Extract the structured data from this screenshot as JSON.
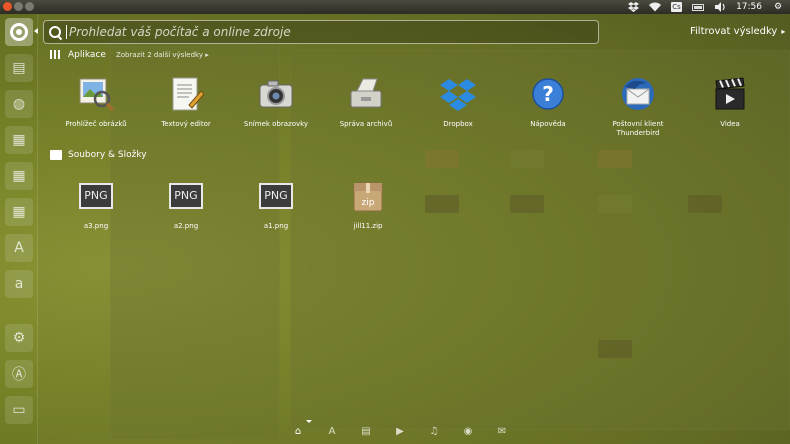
{
  "top_panel": {
    "time": "17:56",
    "keyboard_layout": "Cs",
    "tray_icons": [
      "dropbox-icon",
      "wifi-icon",
      "keyboard-layout-icon",
      "battery-icon",
      "volume-icon",
      "session-gear-icon"
    ]
  },
  "search": {
    "placeholder": "Prohledat váš počítač a online zdroje",
    "value": ""
  },
  "filter": {
    "label": "Filtrovat výsledky"
  },
  "categories": {
    "apps": {
      "title": "Aplikace",
      "more_link": "Zobrazit 2 další výsledky"
    },
    "files": {
      "title": "Soubory & Složky"
    }
  },
  "apps": [
    {
      "label": "Prohlížeč obrázků",
      "icon": "image-viewer-icon"
    },
    {
      "label": "Textový editor",
      "icon": "text-editor-icon"
    },
    {
      "label": "Snímek obrazovky",
      "icon": "screenshot-camera-icon"
    },
    {
      "label": "Správa archivů",
      "icon": "archive-manager-icon"
    },
    {
      "label": "Dropbox",
      "icon": "dropbox-icon"
    },
    {
      "label": "Nápověda",
      "icon": "help-icon"
    },
    {
      "label": "Poštovní klient Thunderbird",
      "icon": "thunderbird-icon"
    },
    {
      "label": "Videa",
      "icon": "video-clapper-icon"
    }
  ],
  "files": [
    {
      "label": "a3.png",
      "badge": "PNG"
    },
    {
      "label": "a2.png",
      "badge": "PNG"
    },
    {
      "label": "a1.png",
      "badge": "PNG"
    },
    {
      "label": "jill11.zip",
      "badge": "zip"
    }
  ],
  "launcher": {
    "items": [
      "dash-home-icon",
      "files-icon",
      "firefox-icon",
      "writer-icon",
      "writer-icon",
      "calc-icon",
      "impress-icon",
      "software-center-icon",
      "amazon-icon",
      "settings-icon",
      "update-manager-icon",
      "terminal-icon"
    ],
    "amazon_glyph": "a"
  },
  "lenses": [
    {
      "name": "home-lens-icon",
      "glyph": "⌂",
      "active": true
    },
    {
      "name": "apps-lens-icon",
      "glyph": "A",
      "active": false
    },
    {
      "name": "files-lens-icon",
      "glyph": "▤",
      "active": false
    },
    {
      "name": "video-lens-icon",
      "glyph": "▶",
      "active": false
    },
    {
      "name": "music-lens-icon",
      "glyph": "♫",
      "active": false
    },
    {
      "name": "photo-lens-icon",
      "glyph": "◉",
      "active": false
    },
    {
      "name": "social-lens-icon",
      "glyph": "✉",
      "active": false
    }
  ],
  "colors": {
    "accent": "#e8562a",
    "dropbox": "#1f7ad6",
    "help": "#2e6fd0"
  }
}
